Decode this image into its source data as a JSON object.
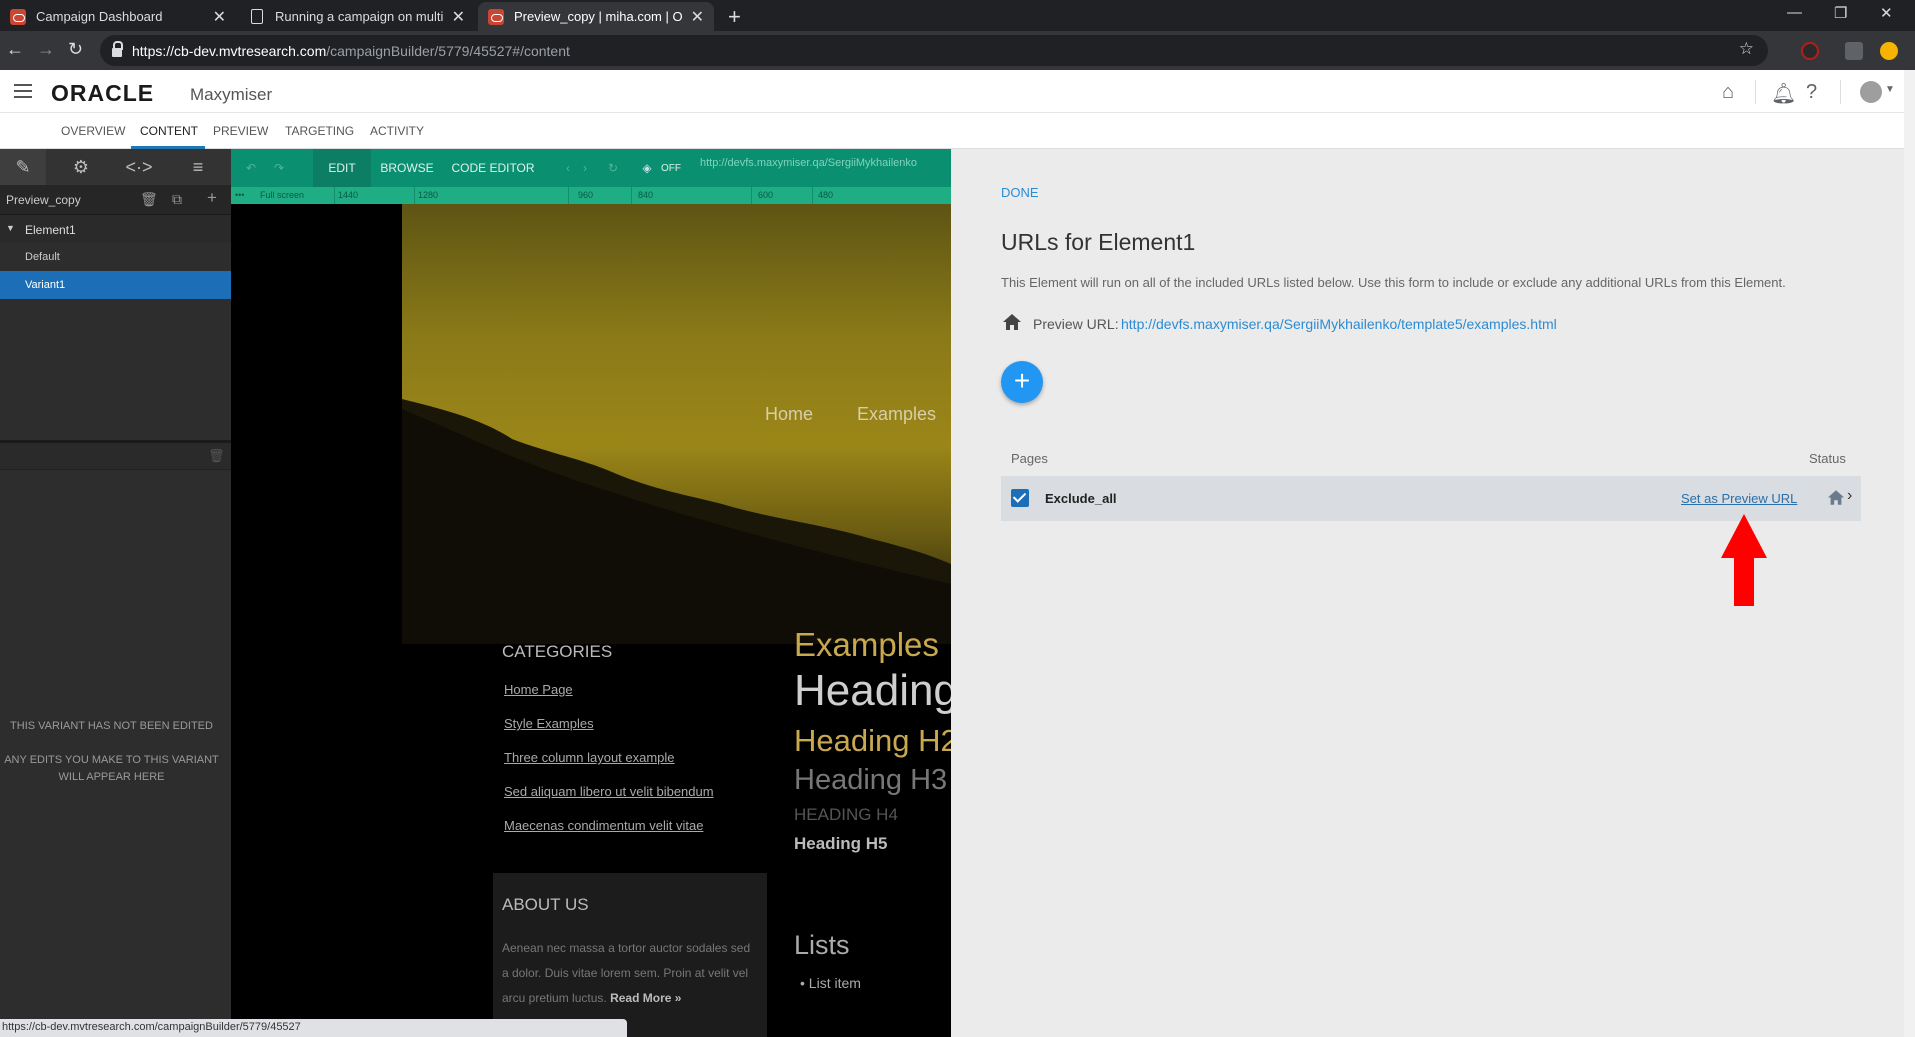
{
  "browser": {
    "tabs": [
      {
        "title": "Campaign Dashboard",
        "icon": "oracle-icon"
      },
      {
        "title": "Running a campaign on multiple",
        "icon": "document-icon"
      },
      {
        "title": "Preview_copy | miha.com | Oracle",
        "icon": "oracle-icon"
      }
    ],
    "url_host": "https://cb-dev.mvtresearch.com",
    "url_path": "/campaignBuilder/5779/45527#/content",
    "status_url": "https://cb-dev.mvtresearch.com/campaignBuilder/5779/45527"
  },
  "app": {
    "logo": "ORACLE",
    "product": "Maxymiser",
    "nav": [
      "OVERVIEW",
      "CONTENT",
      "PREVIEW",
      "TARGETING",
      "ACTIVITY"
    ],
    "active_nav": "CONTENT"
  },
  "left_panel": {
    "campaign_name": "Preview_copy",
    "element": "Element1",
    "variants": [
      "Default",
      "Variant1"
    ],
    "selected_variant": "Variant1",
    "message_line1": "THIS VARIANT HAS NOT BEEN EDITED",
    "message_line2": "ANY EDITS YOU MAKE TO THIS VARIANT WILL APPEAR HERE"
  },
  "canvas": {
    "toolbar": {
      "edit": "EDIT",
      "browse": "BROWSE",
      "code_editor": "CODE EDITOR",
      "toggle": "OFF",
      "url": "http://devfs.maxymiser.qa/SergiiMykhailenko"
    },
    "ruler": {
      "fullscreen": "Full screen",
      "marks": [
        "1440",
        "1280",
        "960",
        "840",
        "600",
        "480"
      ]
    },
    "site": {
      "nav": [
        "Home",
        "Examples"
      ],
      "categories_title": "CATEGORIES",
      "categories": [
        "Home Page",
        "Style Examples",
        "Three column layout example",
        "Sed aliquam libero ut velit bibendum",
        "Maecenas condimentum velit vitae"
      ],
      "examples": "Examples",
      "h1": "Heading",
      "h2": "Heading H2",
      "h3": "Heading H3",
      "h4": "HEADING H4",
      "h5": "Heading H5",
      "about_title": "ABOUT US",
      "about_text": "Aenean nec massa a tortor auctor sodales sed a dolor. Duis vitae lorem sem. Proin at velit vel arcu pretium luctus.",
      "read_more": "Read More »",
      "lists": "Lists",
      "list_item": "List item"
    }
  },
  "right_panel": {
    "done": "DONE",
    "title": "URLs for Element1",
    "description": "This Element will run on all of the included URLs listed below. Use this form to include or exclude any additional URLs from this Element.",
    "preview_label": "Preview URL:",
    "preview_url": "http://devfs.maxymiser.qa/SergiiMykhailenko/template5/examples.html",
    "add_label": "+",
    "col_pages": "Pages",
    "col_status": "Status",
    "rows": [
      {
        "name": "Exclude_all",
        "checked": true,
        "action": "Set as Preview URL"
      }
    ]
  },
  "colors": {
    "accent": "#2196f3",
    "selected": "#1c6fb7",
    "editor_green": "#0a8f70",
    "annotation_arrow": "#ff0000"
  }
}
